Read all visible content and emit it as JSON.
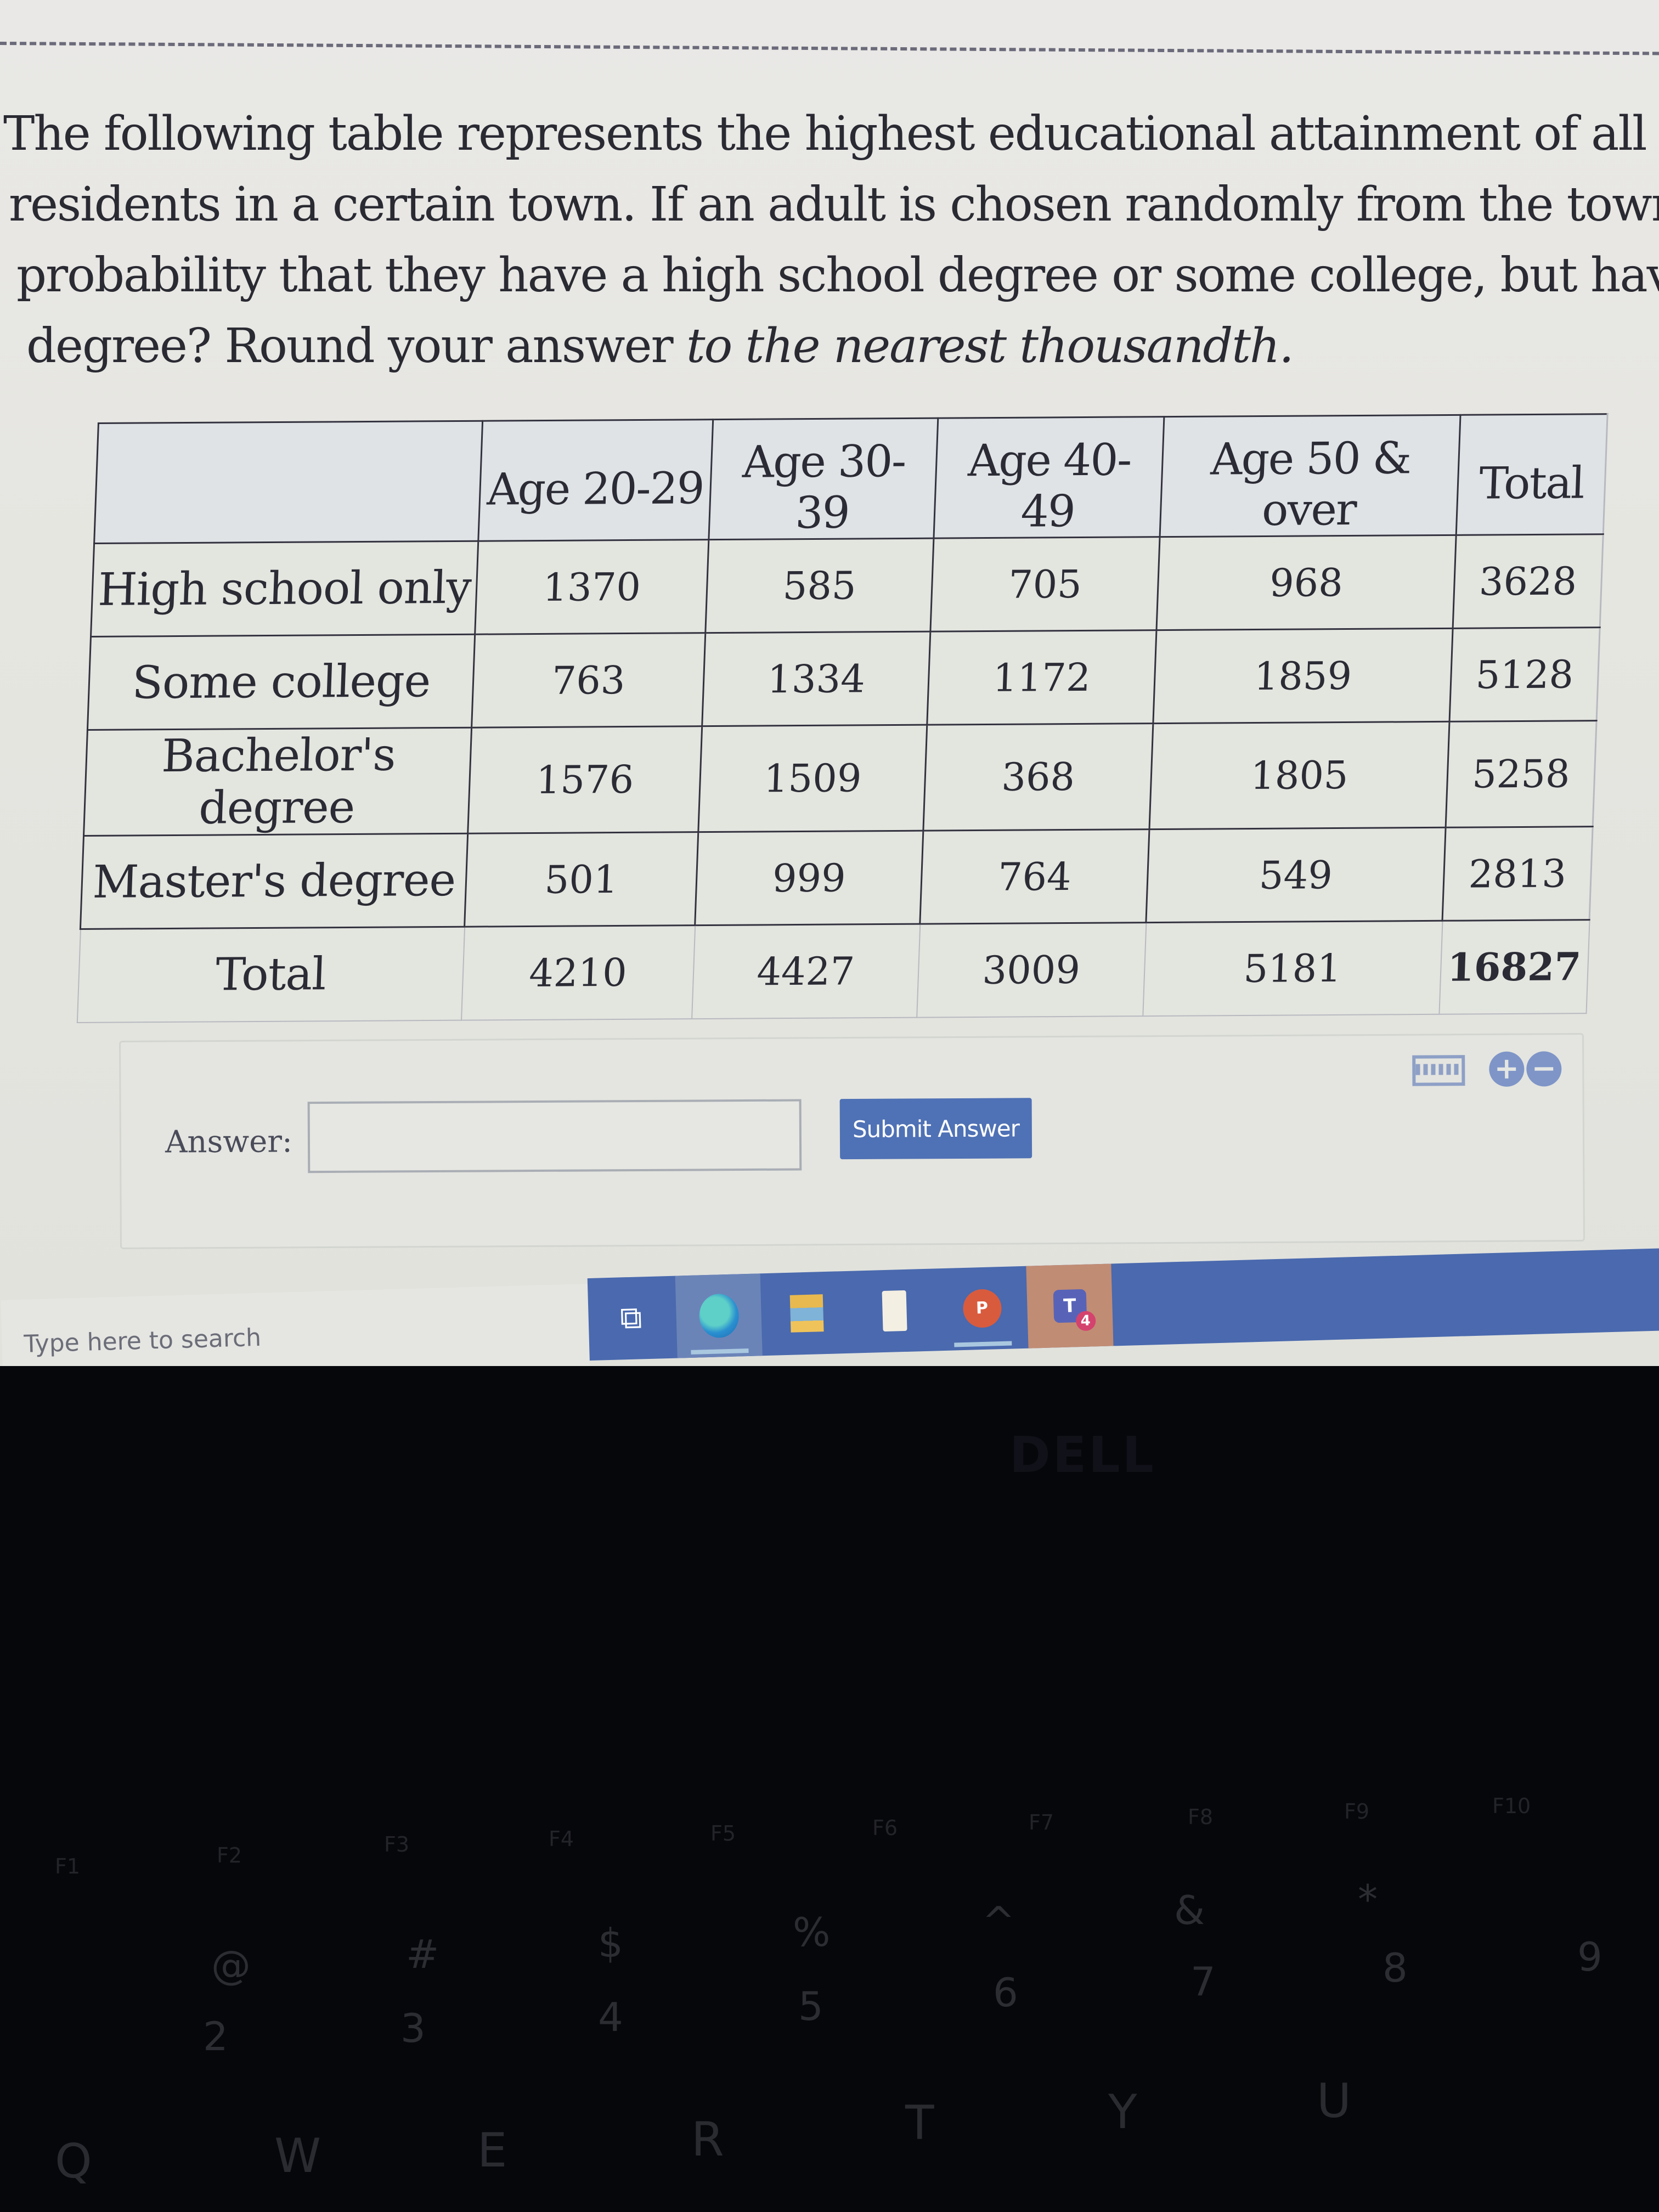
{
  "question": {
    "lines": [
      "The following table represents the highest educational attainment of all adult",
      "residents in a certain town. If an adult is chosen randomly from the town, what is th",
      "probability that they have a high school degree or some college, but have no college"
    ],
    "line4_plain": "degree? Round your answer ",
    "line4_italic": "to the nearest thousandth."
  },
  "table": {
    "columns": [
      "",
      "Age 20-29",
      "Age 30-39",
      "Age 40-49",
      "Age 50 & over",
      "Total"
    ],
    "rows": [
      {
        "label": "High school only",
        "values": [
          "1370",
          "585",
          "705",
          "968",
          "3628"
        ]
      },
      {
        "label": "Some college",
        "values": [
          "763",
          "1334",
          "1172",
          "1859",
          "5128"
        ]
      },
      {
        "label": "Bachelor's degree",
        "values": [
          "1576",
          "1509",
          "368",
          "1805",
          "5258"
        ]
      },
      {
        "label": "Master's degree",
        "values": [
          "501",
          "999",
          "764",
          "549",
          "2813"
        ]
      },
      {
        "label": "Total",
        "values": [
          "4210",
          "4427",
          "3009",
          "5181",
          "16827"
        ]
      }
    ]
  },
  "answer": {
    "label": "Answer:",
    "value": "",
    "placeholder": "",
    "submit_label": "Submit Answer",
    "tools": {
      "keyboard_icon": "keyboard-icon",
      "zoom_in_glyph": "+",
      "zoom_out_glyph": "−"
    }
  },
  "taskbar": {
    "search_placeholder": "Type here to search",
    "apps": [
      {
        "name": "task-view",
        "glyph": "⧉"
      },
      {
        "name": "edge",
        "glyph": ""
      },
      {
        "name": "file-explorer",
        "glyph": ""
      },
      {
        "name": "notepad",
        "glyph": ""
      },
      {
        "name": "powerpoint",
        "glyph": "P"
      },
      {
        "name": "teams",
        "glyph": "T",
        "badge": "4"
      }
    ]
  },
  "device": {
    "brand": "DELL",
    "function_keys": [
      "F1",
      "F2",
      "F3",
      "F4",
      "F5",
      "F6",
      "F7",
      "F8",
      "F9",
      "F10"
    ],
    "symbol_keys": [
      "@",
      "#",
      "$",
      "%",
      "^",
      "&",
      "*"
    ],
    "number_keys": [
      "2",
      "3",
      "4",
      "5",
      "6",
      "7",
      "8",
      "9"
    ],
    "letter_keys": [
      "Q",
      "W",
      "E",
      "R",
      "T",
      "Y",
      "U"
    ]
  },
  "colors": {
    "submit_button": "#4f71b5",
    "taskbar": "#4a69ae",
    "text": "#2a2a33"
  }
}
